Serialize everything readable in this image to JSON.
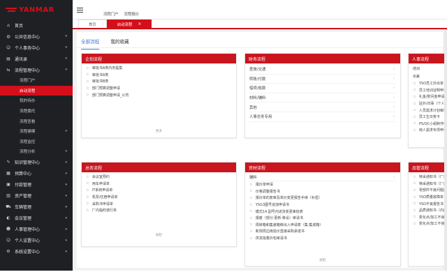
{
  "brand": {
    "name": "YANMAR",
    "color": "#d40f1a"
  },
  "sidebar": {
    "items": [
      {
        "icon": "home-icon",
        "label": "首页"
      },
      {
        "icon": "globe-icon",
        "label": "公共信息中心",
        "chevron": true
      },
      {
        "icon": "user-icon",
        "label": "个人事务中心",
        "chevron": true
      },
      {
        "icon": "book-icon",
        "label": "通讯录",
        "chevron": true
      },
      {
        "icon": "flow-icon",
        "label": "流程管理中心",
        "chevron": true
      }
    ],
    "sub_items": [
      {
        "label": "流程门户",
        "active": false
      },
      {
        "label": "启动流程",
        "active": true
      },
      {
        "label": "我的待办",
        "active": false
      },
      {
        "label": "流程委托",
        "active": false
      },
      {
        "label": "流程查看",
        "active": false
      },
      {
        "label": "流程建模",
        "active": false,
        "chevron": true
      },
      {
        "label": "流程监控",
        "active": false
      },
      {
        "label": "流程分析",
        "active": false,
        "chevron": true
      }
    ],
    "items_after": [
      {
        "icon": "knowledge-icon",
        "label": "知识管理中心",
        "chevron": true
      },
      {
        "icon": "budget-icon",
        "label": "预算中心",
        "chevron": true
      },
      {
        "icon": "purchase-icon",
        "label": "付款管理",
        "chevron": true
      },
      {
        "icon": "assets-icon",
        "label": "资产管理",
        "chevron": true
      },
      {
        "icon": "car-icon",
        "label": "车辆管理",
        "chevron": true
      },
      {
        "icon": "meeting-icon",
        "label": "会议管理",
        "chevron": true
      },
      {
        "icon": "hr-icon",
        "label": "人事管理中心",
        "chevron": true
      },
      {
        "icon": "personal-icon",
        "label": "个人设置中心",
        "chevron": true
      },
      {
        "icon": "settings-icon",
        "label": "系统设置中心",
        "chevron": true
      }
    ]
  },
  "header": {
    "breadcrumbs": [
      "流程门户",
      "流程报价"
    ],
    "tabs": [
      {
        "label": "首页",
        "active": false
      },
      {
        "label": "启动流程",
        "active": true,
        "closable": true,
        "close": "×"
      }
    ]
  },
  "subtabs": [
    {
      "label": "全部流程",
      "active": true
    },
    {
      "label": "我的收藏",
      "active": false
    }
  ],
  "cards": {
    "enterprise": {
      "title": "企划流程",
      "items": [
        "审批书A类内务提案",
        "审批书A类",
        "审批书B类",
        "部门预算调整申请",
        "部门预算调整申请_公司"
      ],
      "more": "更多"
    },
    "finance": {
      "title": "财务流程",
      "items": [
        "差旅/交通",
        "转账/付款",
        "借项/收款",
        "材料/辅料",
        "其他",
        "人事总务专用"
      ]
    },
    "hr": {
      "title": "人事流程",
      "items": [
        "培训",
        "出差",
        "YSO员工外出单",
        "员工培训证明申请单",
        "礼金/慰问金申请单",
        "驻外/归事（个人）",
        "人员需求计划审批单",
        "员工生日贺卡",
        "PS/QC小组制作申请",
        "用人需求专项申请单"
      ]
    },
    "general": {
      "title": "总务流程",
      "items": [
        "会议室预约",
        "用车申请单",
        "IT系统申请单",
        "机票/住宿申请单",
        "采购书申请单",
        "厂内临时通行单"
      ],
      "more": "收起"
    },
    "material": {
      "title": "资材流程",
      "items_header": "辅料",
      "items": [
        "报价单申请",
        "价格调整报告书",
        "报价单的复审及单价变更报告手续（补遗）",
        "YSG3图号追加申请书",
        "模式14.副号内进货变更审批表",
        "报废（部分·更新·移设）审请书",
        "周转箱和集装箱移出入申请表（集·集成箱）",
        "新规周边用造价直接采购承诺书"
      ],
      "last_item": "供货批量外包审请书",
      "more": "收起"
    },
    "quality": {
      "title": "品管流程",
      "items": [
        "特采通知书（厂外）",
        "特采通知书（厂内）",
        "零部件不良问题报告",
        "YSO质量故障单",
        "YSO不良报告书",
        "品质通知书（内部）",
        "变化点/加工不良",
        "变化点/加工不良处理书"
      ]
    }
  }
}
